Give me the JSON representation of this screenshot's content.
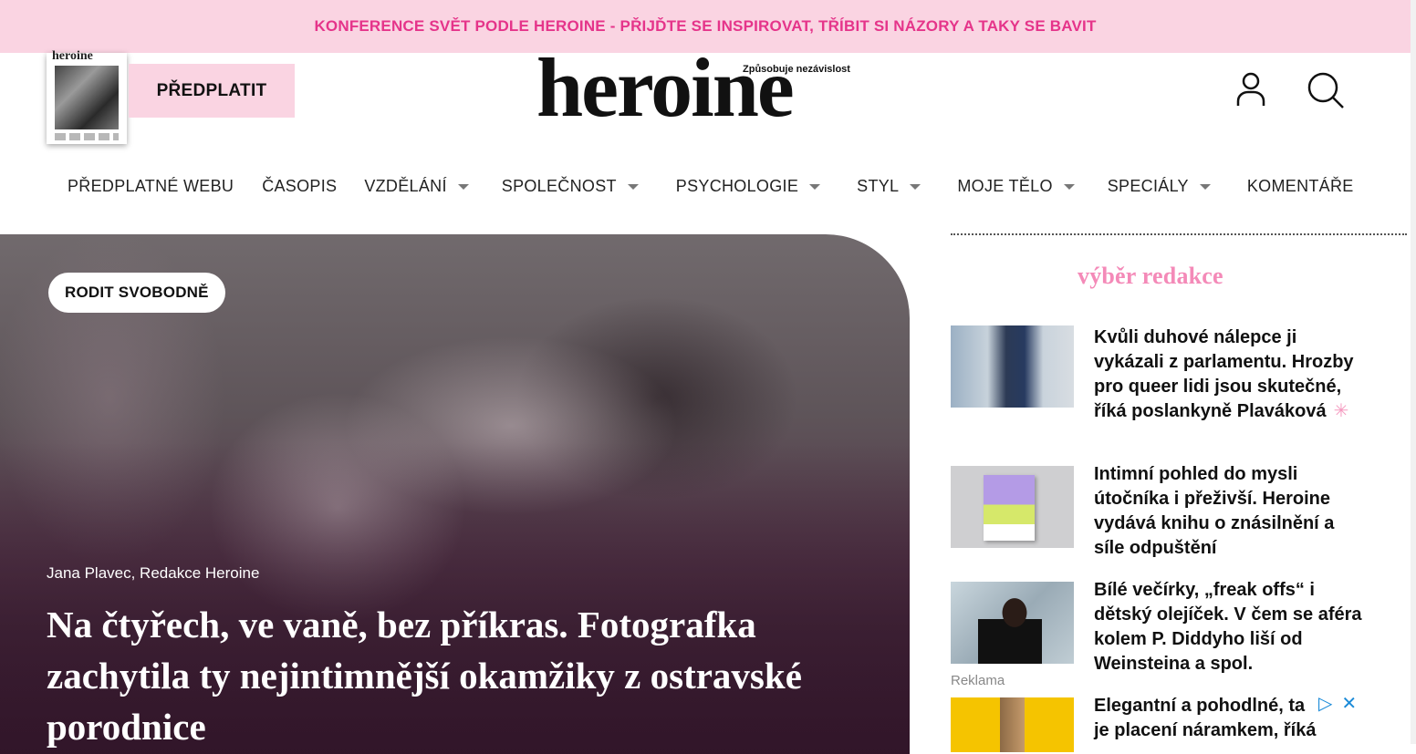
{
  "announcement": {
    "text": "KONFERENCE SVĚT PODLE HEROINE - PŘIJĎTE SE INSPIROVAT, TŘÍBIT SI NÁZORY A TAKY SE BAVIT"
  },
  "header": {
    "cover_masthead": "heroine",
    "subscribe_label": "PŘEDPLATIT",
    "logo_text": "heroine",
    "logo_tagline": "Způsobuje nezávislost",
    "icons": {
      "account": "user-icon",
      "search": "search-icon"
    }
  },
  "nav": {
    "items": [
      {
        "label": "PŘEDPLATNÉ WEBU",
        "has_dropdown": false
      },
      {
        "label": "ČASOPIS",
        "has_dropdown": false
      },
      {
        "label": "VZDĚLÁNÍ",
        "has_dropdown": true
      },
      {
        "label": "SPOLEČNOST",
        "has_dropdown": true
      },
      {
        "label": "PSYCHOLOGIE",
        "has_dropdown": true
      },
      {
        "label": "STYL",
        "has_dropdown": true
      },
      {
        "label": "MOJE TĚLO",
        "has_dropdown": true
      },
      {
        "label": "SPECIÁLY",
        "has_dropdown": true
      },
      {
        "label": "KOMENTÁŘE",
        "has_dropdown": false
      }
    ]
  },
  "hero": {
    "tag": "RODIT SVOBODNĚ",
    "authors": "Jana Plavec, Redakce Heroine",
    "title": "Na čtyřech, ve vaně, bez příkras. Fotografka zachytila ty nejintimnější okamžiky z ostravské porodnice"
  },
  "sidebar": {
    "heading": "výběr redakce",
    "picks": [
      {
        "title": "Kvůli duhové nálepce ji vykázali z parlamentu. Hrozby pro queer lidi jsou skutečné, říká poslankyně Plaváková",
        "asterisk": "✳"
      },
      {
        "title": "Intimní pohled do mysli útočníka i přeživší. Heroine vydává knihu o znásilnění a síle odpuštění"
      },
      {
        "title": "Bílé večírky, „freak offs“ i dětský olejíček. V čem se aféra kolem P. Diddyho liší od Weinsteina a spol."
      },
      {
        "title": "Elegantní a pohodlné, ta je placení náramkem, říká"
      }
    ],
    "ad_label": "Reklama",
    "ad_icons": {
      "adchoices": "▷",
      "close": "✕"
    }
  },
  "colors": {
    "pink_bg": "#fad4e2",
    "pink_text": "#e5348a",
    "editor_pink": "#f48ab8",
    "ad_blue": "#1a8ad8"
  }
}
